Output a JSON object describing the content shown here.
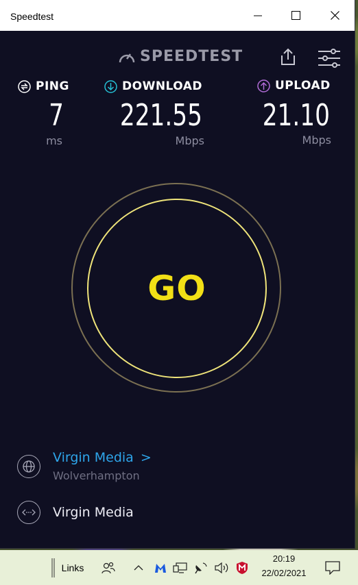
{
  "window": {
    "title": "Speedtest"
  },
  "brand": {
    "name": "SPEEDTEST"
  },
  "metrics": {
    "ping": {
      "label": "PING",
      "value": "7",
      "unit": "ms",
      "color": "#ffffff"
    },
    "download": {
      "label": "DOWNLOAD",
      "value": "221.55",
      "unit": "Mbps",
      "color": "#25c1d6"
    },
    "upload": {
      "label": "UPLOAD",
      "value": "21.10",
      "unit": "Mbps",
      "color": "#b06bd6"
    }
  },
  "go_button": {
    "label": "GO",
    "color": "#f2df16"
  },
  "server": {
    "host": "Virgin Media",
    "chevron": ">",
    "location": "Wolverhampton"
  },
  "provider": {
    "name": "Virgin Media"
  },
  "taskbar": {
    "links_label": "Links",
    "time": "20:19",
    "date": "22/02/2021"
  }
}
